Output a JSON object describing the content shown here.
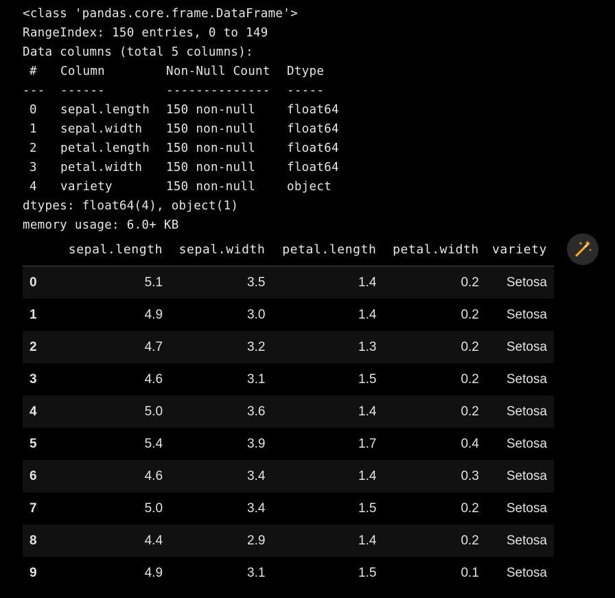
{
  "info": {
    "class_line": "<class 'pandas.core.frame.DataFrame'>",
    "range_index": "RangeIndex: 150 entries, 0 to 149",
    "data_columns": "Data columns (total 5 columns):",
    "header": {
      "idx": "#",
      "column": "Column",
      "non_null": "Non-Null Count",
      "dtype": "Dtype"
    },
    "separator": {
      "idx": "---",
      "column": "------",
      "non_null": "--------------",
      "dtype": "-----"
    },
    "rows": [
      {
        "idx": "0",
        "column": "sepal.length",
        "non_null": "150 non-null",
        "dtype": "float64"
      },
      {
        "idx": "1",
        "column": "sepal.width",
        "non_null": "150 non-null",
        "dtype": "float64"
      },
      {
        "idx": "2",
        "column": "petal.length",
        "non_null": "150 non-null",
        "dtype": "float64"
      },
      {
        "idx": "3",
        "column": "petal.width",
        "non_null": "150 non-null",
        "dtype": "float64"
      },
      {
        "idx": "4",
        "column": "variety",
        "non_null": "150 non-null",
        "dtype": "object"
      }
    ],
    "dtypes": "dtypes: float64(4), object(1)",
    "memory": "memory usage: 6.0+ KB"
  },
  "table": {
    "columns": [
      "",
      "sepal.length",
      "sepal.width",
      "petal.length",
      "petal.width",
      "variety"
    ],
    "rows": [
      [
        "0",
        "5.1",
        "3.5",
        "1.4",
        "0.2",
        "Setosa"
      ],
      [
        "1",
        "4.9",
        "3.0",
        "1.4",
        "0.2",
        "Setosa"
      ],
      [
        "2",
        "4.7",
        "3.2",
        "1.3",
        "0.2",
        "Setosa"
      ],
      [
        "3",
        "4.6",
        "3.1",
        "1.5",
        "0.2",
        "Setosa"
      ],
      [
        "4",
        "5.0",
        "3.6",
        "1.4",
        "0.2",
        "Setosa"
      ],
      [
        "5",
        "5.4",
        "3.9",
        "1.7",
        "0.4",
        "Setosa"
      ],
      [
        "6",
        "4.6",
        "3.4",
        "1.4",
        "0.3",
        "Setosa"
      ],
      [
        "7",
        "5.0",
        "3.4",
        "1.5",
        "0.2",
        "Setosa"
      ],
      [
        "8",
        "4.4",
        "2.9",
        "1.4",
        "0.2",
        "Setosa"
      ],
      [
        "9",
        "4.9",
        "3.1",
        "1.5",
        "0.1",
        "Setosa"
      ]
    ]
  },
  "toolbar": {
    "magic_icon": "magic-wand-icon"
  },
  "colors": {
    "background": "#000000",
    "text": "#e8e8e8",
    "row_alt": "#111111",
    "icon_accent": "#f5a623",
    "icon_bg": "#2b2b2b"
  }
}
